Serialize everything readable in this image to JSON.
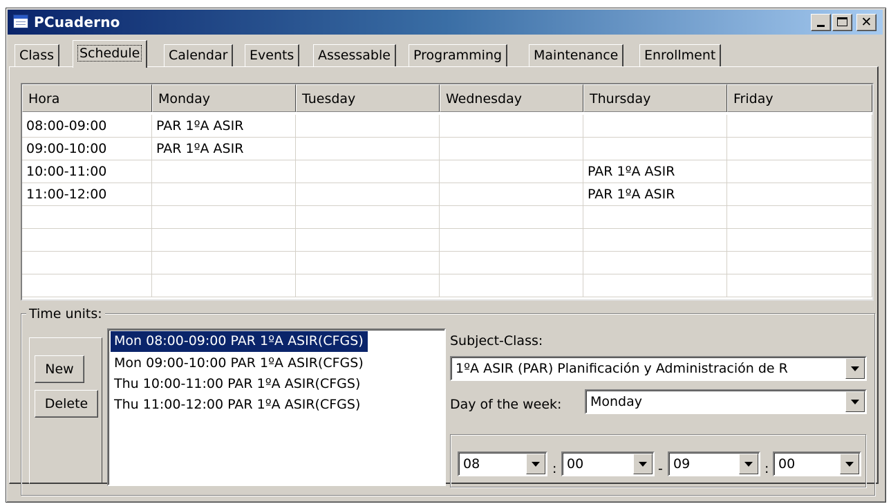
{
  "window": {
    "title": "PCuaderno",
    "controls": {
      "minimize": "_",
      "close": "✕"
    }
  },
  "tabs": [
    {
      "label": "Class",
      "active": false
    },
    {
      "label": "Schedule",
      "active": true
    },
    {
      "label": "Calendar",
      "active": false
    },
    {
      "label": "Events",
      "active": false
    },
    {
      "label": "Assessable",
      "active": false
    },
    {
      "label": "Programming",
      "active": false
    },
    {
      "label": "Maintenance",
      "active": false
    },
    {
      "label": "Enrollment",
      "active": false
    }
  ],
  "schedule": {
    "columns": [
      "Hora",
      "Monday",
      "Tuesday",
      "Wednesday",
      "Thursday",
      "Friday"
    ],
    "rows": [
      [
        "08:00-09:00",
        "PAR 1ºA ASIR",
        "",
        "",
        "",
        ""
      ],
      [
        "09:00-10:00",
        "PAR 1ºA ASIR",
        "",
        "",
        "",
        ""
      ],
      [
        "10:00-11:00",
        "",
        "",
        "",
        "PAR 1ºA ASIR",
        ""
      ],
      [
        "11:00-12:00",
        "",
        "",
        "",
        "PAR 1ºA ASIR",
        ""
      ],
      [
        "",
        "",
        "",
        "",
        "",
        ""
      ],
      [
        "",
        "",
        "",
        "",
        "",
        ""
      ],
      [
        "",
        "",
        "",
        "",
        "",
        ""
      ],
      [
        "",
        "",
        "",
        "",
        "",
        ""
      ]
    ]
  },
  "time_units": {
    "label": "Time units:",
    "new_label": "New",
    "delete_label": "Delete",
    "items": [
      "Mon 08:00-09:00 PAR 1ºA ASIR(CFGS)",
      "Mon 09:00-10:00 PAR 1ºA ASIR(CFGS)",
      "Thu 10:00-11:00 PAR 1ºA ASIR(CFGS)",
      "Thu 11:00-12:00 PAR 1ºA ASIR(CFGS)"
    ],
    "selected_index": 0,
    "subject_class_label": "Subject-Class:",
    "subject_class_value": "1ºA ASIR (PAR) Planificación y Administración de R",
    "day_label": "Day of the week:",
    "day_value": "Monday",
    "start_hour": "08",
    "start_minute": "00",
    "end_hour": "09",
    "end_minute": "00",
    "colon": ":",
    "dash": "-"
  },
  "colors": {
    "titlebar_start": "#0a246a",
    "titlebar_end": "#a6caf0",
    "face": "#d4d0c8",
    "selection": "#0a246a"
  }
}
